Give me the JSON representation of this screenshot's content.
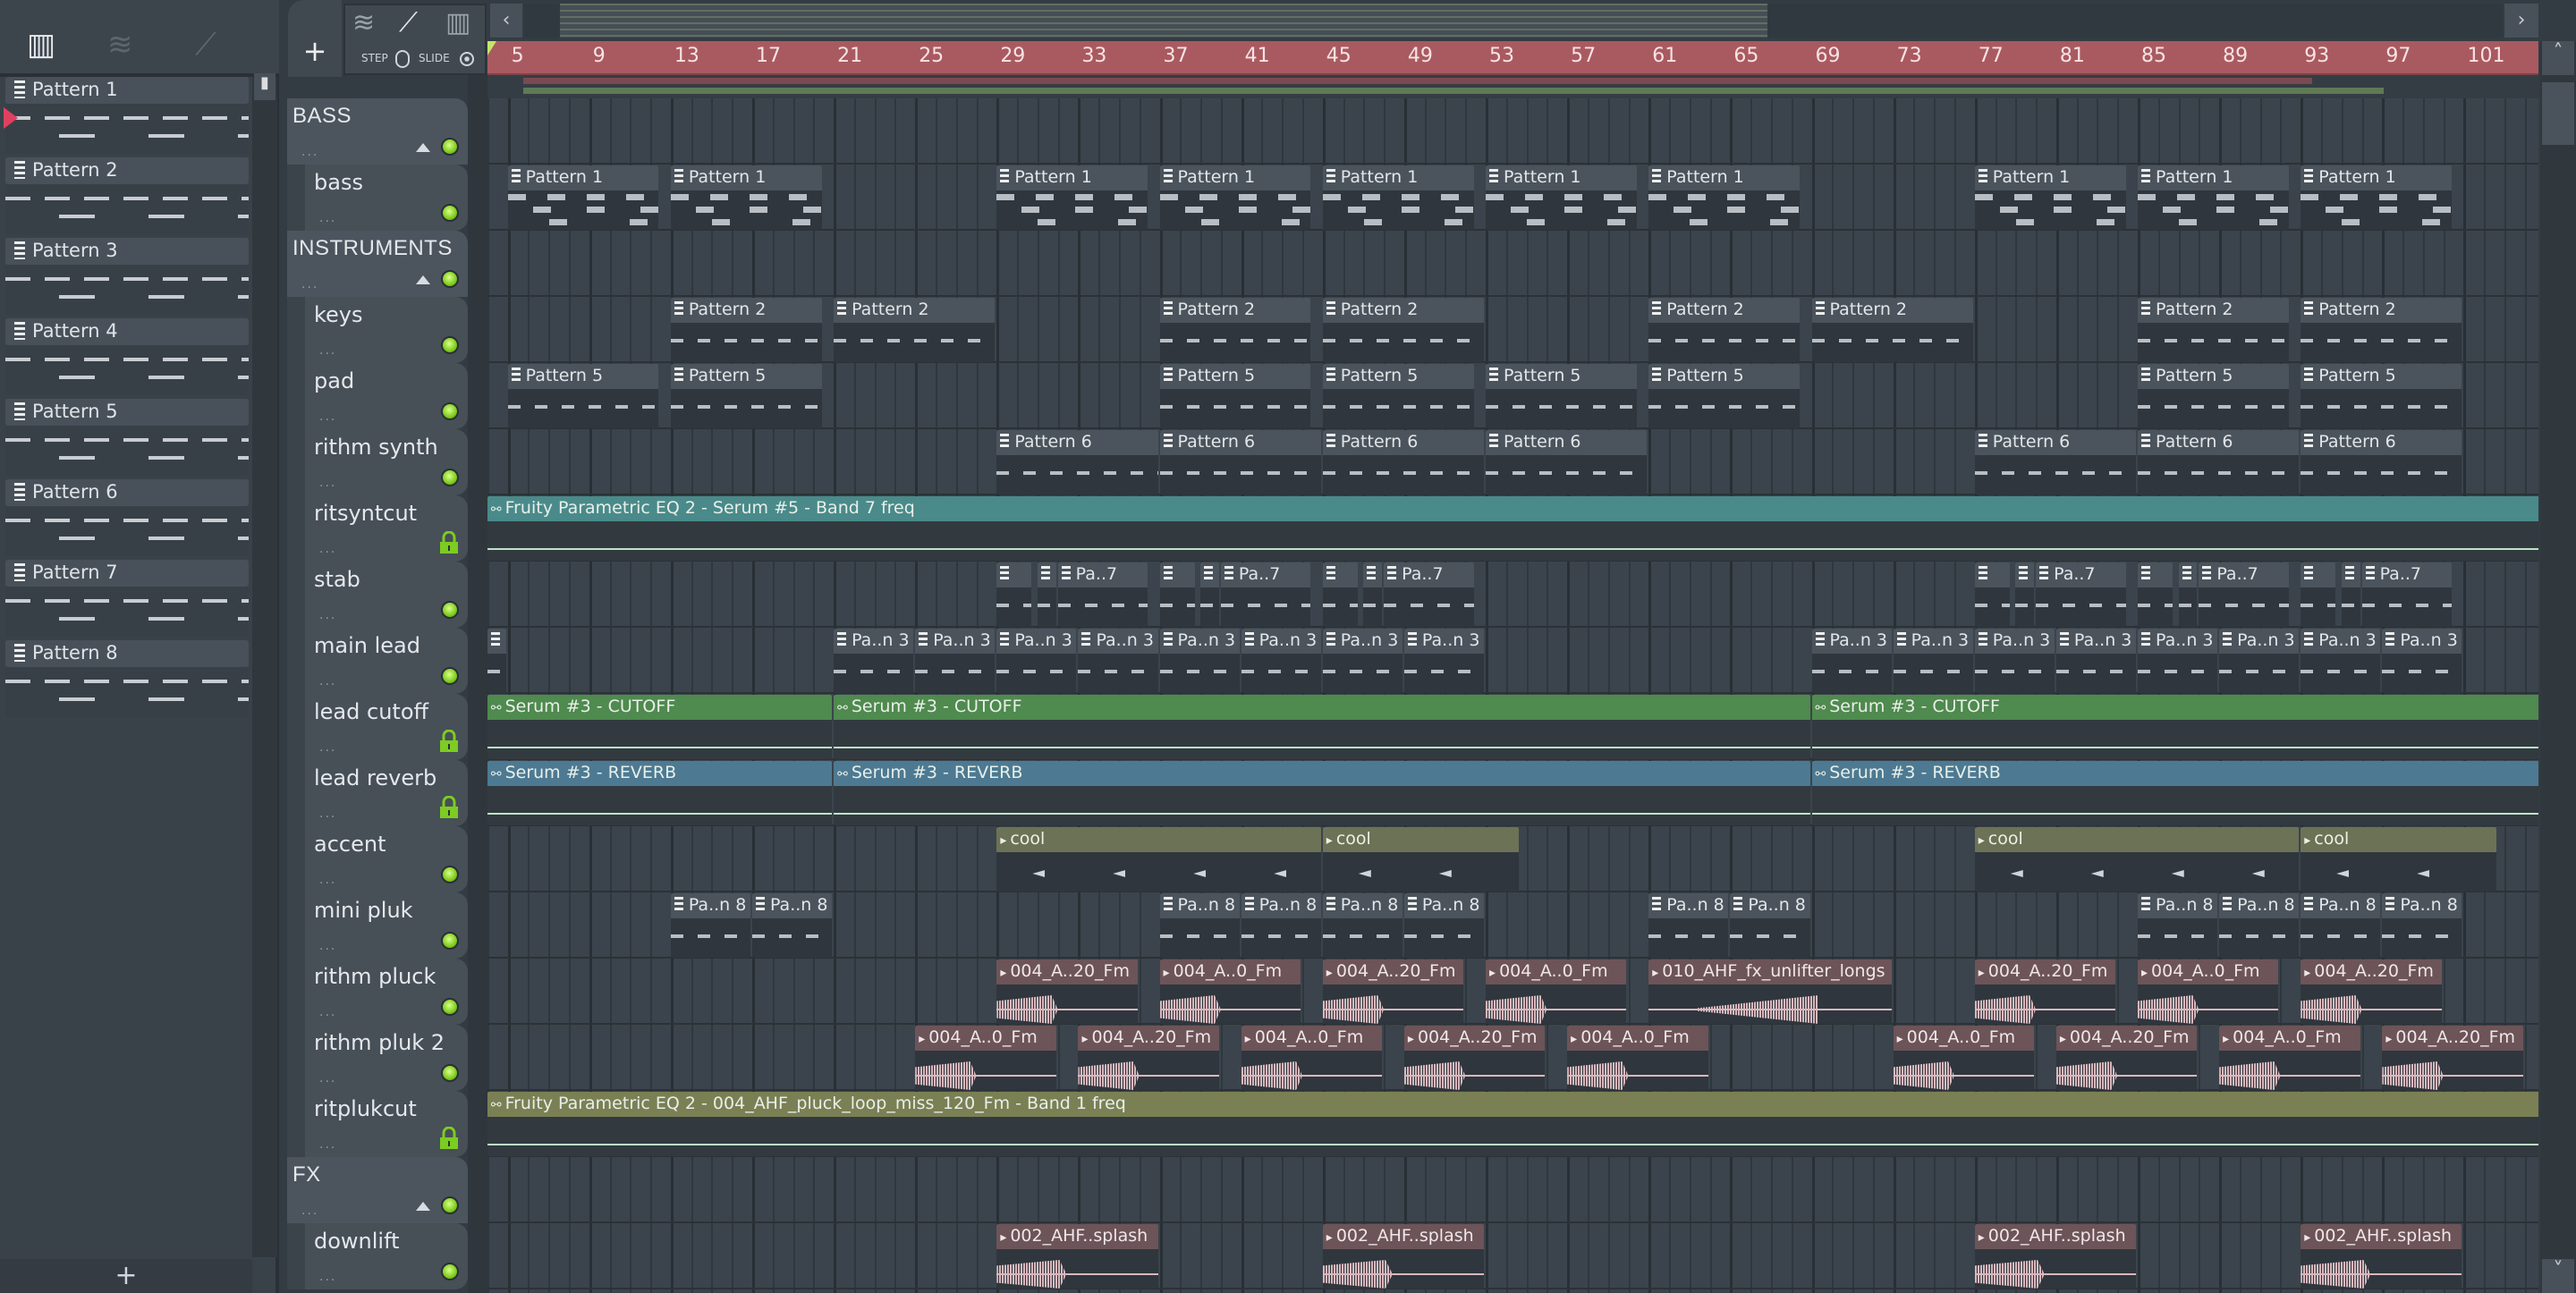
{
  "toolbar": {
    "left_icons": [
      "piano-roll-icon",
      "audio-wave-icon",
      "automation-icon"
    ],
    "add_label": "+",
    "step_label": "STEP",
    "slide_label": "SLIDE",
    "tool_icons": [
      "audio-wave-icon",
      "automation-icon",
      "piano-roll-icon"
    ],
    "scroll_left": "‹",
    "scroll_right": "›"
  },
  "patterns": [
    "Pattern 1",
    "Pattern 2",
    "Pattern 3",
    "Pattern 4",
    "Pattern 5",
    "Pattern 6",
    "Pattern 7",
    "Pattern 8"
  ],
  "add_pattern_label": "+",
  "ruler": {
    "first_bar_visible": 4,
    "labels": [
      5,
      9,
      13,
      17,
      21,
      25,
      29,
      33,
      37,
      41,
      45,
      49,
      53,
      57,
      61,
      65,
      69,
      73,
      77,
      81,
      85,
      89,
      93,
      97,
      101
    ]
  },
  "colors": {
    "ruler": "#a95a60",
    "led": "#7fcc1c",
    "teal_auto": "#4a8a8a",
    "green_auto": "#4f8a4e",
    "blue_auto": "#4d7a92",
    "olive_auto": "#7a8054",
    "audio": "#6c5458"
  },
  "tracks": [
    {
      "name": "BASS",
      "group": true
    },
    {
      "name": "bass",
      "clips": [
        {
          "type": "pattern",
          "label": "Pattern 1",
          "start": 5,
          "len": 7.5,
          "style": "bass"
        },
        {
          "type": "pattern",
          "label": "Pattern 1",
          "start": 13,
          "len": 7.5,
          "style": "bass"
        },
        {
          "type": "pattern",
          "label": "Pattern 1",
          "start": 29,
          "len": 7.5,
          "style": "bass"
        },
        {
          "type": "pattern",
          "label": "Pattern 1",
          "start": 37,
          "len": 7.5,
          "style": "bass"
        },
        {
          "type": "pattern",
          "label": "Pattern 1",
          "start": 45,
          "len": 7.5,
          "style": "bass"
        },
        {
          "type": "pattern",
          "label": "Pattern 1",
          "start": 53,
          "len": 7.5,
          "style": "bass"
        },
        {
          "type": "pattern",
          "label": "Pattern 1",
          "start": 61,
          "len": 7.5,
          "style": "bass"
        },
        {
          "type": "pattern",
          "label": "Pattern 1",
          "start": 77,
          "len": 7.5,
          "style": "bass"
        },
        {
          "type": "pattern",
          "label": "Pattern 1",
          "start": 85,
          "len": 7.5,
          "style": "bass"
        },
        {
          "type": "pattern",
          "label": "Pattern 1",
          "start": 93,
          "len": 7.5,
          "style": "bass"
        }
      ]
    },
    {
      "name": "INSTRUMENTS",
      "group": true
    },
    {
      "name": "keys",
      "clips": [
        {
          "type": "pattern",
          "label": "Pattern 2",
          "start": 13,
          "len": 7.5
        },
        {
          "type": "pattern",
          "label": "Pattern 2",
          "start": 21,
          "len": 8
        },
        {
          "type": "pattern",
          "label": "Pattern 2",
          "start": 37,
          "len": 7.5
        },
        {
          "type": "pattern",
          "label": "Pattern 2",
          "start": 45,
          "len": 8
        },
        {
          "type": "pattern",
          "label": "Pattern 2",
          "start": 61,
          "len": 7.5
        },
        {
          "type": "pattern",
          "label": "Pattern 2",
          "start": 69,
          "len": 8
        },
        {
          "type": "pattern",
          "label": "Pattern 2",
          "start": 85,
          "len": 7.5
        },
        {
          "type": "pattern",
          "label": "Pattern 2",
          "start": 93,
          "len": 8
        }
      ]
    },
    {
      "name": "pad",
      "clips": [
        {
          "type": "pattern",
          "label": "Pattern 5",
          "start": 5,
          "len": 7.5
        },
        {
          "type": "pattern",
          "label": "Pattern 5",
          "start": 13,
          "len": 7.5
        },
        {
          "type": "pattern",
          "label": "Pattern 5",
          "start": 37,
          "len": 7.5
        },
        {
          "type": "pattern",
          "label": "Pattern 5",
          "start": 45,
          "len": 7.5
        },
        {
          "type": "pattern",
          "label": "Pattern 5",
          "start": 53,
          "len": 7.5
        },
        {
          "type": "pattern",
          "label": "Pattern 5",
          "start": 61,
          "len": 7.5
        },
        {
          "type": "pattern",
          "label": "Pattern 5",
          "start": 85,
          "len": 7.5
        },
        {
          "type": "pattern",
          "label": "Pattern 5",
          "start": 93,
          "len": 8
        }
      ]
    },
    {
      "name": "rithm synth",
      "clips": [
        {
          "type": "pattern",
          "label": "Pattern 6",
          "start": 29,
          "len": 8
        },
        {
          "type": "pattern",
          "label": "Pattern 6",
          "start": 37,
          "len": 8
        },
        {
          "type": "pattern",
          "label": "Pattern 6",
          "start": 45,
          "len": 8
        },
        {
          "type": "pattern",
          "label": "Pattern 6",
          "start": 53,
          "len": 8
        },
        {
          "type": "pattern",
          "label": "Pattern 6",
          "start": 77,
          "len": 8
        },
        {
          "type": "pattern",
          "label": "Pattern 6",
          "start": 85,
          "len": 8
        },
        {
          "type": "pattern",
          "label": "Pattern 6",
          "start": 93,
          "len": 8
        }
      ]
    },
    {
      "name": "ritsyntcut",
      "locked": true,
      "clips": [
        {
          "type": "auto",
          "label": "Fruity Parametric EQ 2 - Serum #5 - Band 7 freq",
          "start": 4,
          "len": 101,
          "color": "teal_auto"
        }
      ]
    },
    {
      "name": "stab",
      "clips": [
        {
          "type": "pattern",
          "label": "",
          "start": 29,
          "len": 1.8
        },
        {
          "type": "pattern",
          "label": "",
          "start": 31,
          "len": 1
        },
        {
          "type": "pattern",
          "label": "Pa..7",
          "start": 32,
          "len": 4.5
        },
        {
          "type": "pattern",
          "label": "",
          "start": 37,
          "len": 1.8
        },
        {
          "type": "pattern",
          "label": "",
          "start": 39,
          "len": 1
        },
        {
          "type": "pattern",
          "label": "Pa..7",
          "start": 40,
          "len": 4.5
        },
        {
          "type": "pattern",
          "label": "",
          "start": 45,
          "len": 1.8
        },
        {
          "type": "pattern",
          "label": "",
          "start": 47,
          "len": 1
        },
        {
          "type": "pattern",
          "label": "Pa..7",
          "start": 48,
          "len": 4.5
        },
        {
          "type": "pattern",
          "label": "",
          "start": 77,
          "len": 1.8
        },
        {
          "type": "pattern",
          "label": "",
          "start": 79,
          "len": 1
        },
        {
          "type": "pattern",
          "label": "Pa..7",
          "start": 80,
          "len": 4.5
        },
        {
          "type": "pattern",
          "label": "",
          "start": 85,
          "len": 1.8
        },
        {
          "type": "pattern",
          "label": "",
          "start": 87,
          "len": 1
        },
        {
          "type": "pattern",
          "label": "Pa..7",
          "start": 88,
          "len": 4.5
        },
        {
          "type": "pattern",
          "label": "",
          "start": 93,
          "len": 1.8
        },
        {
          "type": "pattern",
          "label": "",
          "start": 95,
          "len": 1
        },
        {
          "type": "pattern",
          "label": "Pa..7",
          "start": 96,
          "len": 4.5
        }
      ]
    },
    {
      "name": "main lead",
      "clips": [
        {
          "type": "pattern",
          "label": "",
          "start": 4,
          "len": 1
        },
        {
          "type": "pattern",
          "label": "Pa..n 3",
          "start": 21,
          "len": 4
        },
        {
          "type": "pattern",
          "label": "Pa..n 3",
          "start": 25,
          "len": 4
        },
        {
          "type": "pattern",
          "label": "Pa..n 3",
          "start": 29,
          "len": 4
        },
        {
          "type": "pattern",
          "label": "Pa..n 3",
          "start": 33,
          "len": 4
        },
        {
          "type": "pattern",
          "label": "Pa..n 3",
          "start": 37,
          "len": 4
        },
        {
          "type": "pattern",
          "label": "Pa..n 3",
          "start": 41,
          "len": 4
        },
        {
          "type": "pattern",
          "label": "Pa..n 3",
          "start": 45,
          "len": 4
        },
        {
          "type": "pattern",
          "label": "Pa..n 3",
          "start": 49,
          "len": 4
        },
        {
          "type": "pattern",
          "label": "Pa..n 3",
          "start": 69,
          "len": 4
        },
        {
          "type": "pattern",
          "label": "Pa..n 3",
          "start": 73,
          "len": 4
        },
        {
          "type": "pattern",
          "label": "Pa..n 3",
          "start": 77,
          "len": 4
        },
        {
          "type": "pattern",
          "label": "Pa..n 3",
          "start": 81,
          "len": 4
        },
        {
          "type": "pattern",
          "label": "Pa..n 3",
          "start": 85,
          "len": 4
        },
        {
          "type": "pattern",
          "label": "Pa..n 3",
          "start": 89,
          "len": 4
        },
        {
          "type": "pattern",
          "label": "Pa..n 3",
          "start": 93,
          "len": 4
        },
        {
          "type": "pattern",
          "label": "Pa..n 3",
          "start": 97,
          "len": 4
        }
      ]
    },
    {
      "name": "lead cutoff",
      "locked": true,
      "clips": [
        {
          "type": "auto",
          "label": "Serum #3 - CUTOFF",
          "start": 4,
          "len": 17,
          "color": "green_auto"
        },
        {
          "type": "auto",
          "label": "Serum #3 - CUTOFF",
          "start": 21,
          "len": 48,
          "color": "green_auto"
        },
        {
          "type": "auto",
          "label": "Serum #3 - CUTOFF",
          "start": 69,
          "len": 36,
          "color": "green_auto"
        }
      ]
    },
    {
      "name": "lead reverb",
      "locked": true,
      "clips": [
        {
          "type": "auto",
          "label": "Serum #3 - REVERB",
          "start": 4,
          "len": 17,
          "color": "blue_auto"
        },
        {
          "type": "auto",
          "label": "Serum #3 - REVERB",
          "start": 21,
          "len": 48,
          "color": "blue_auto"
        },
        {
          "type": "auto",
          "label": "Serum #3 - REVERB",
          "start": 69,
          "len": 36,
          "color": "blue_auto"
        }
      ]
    },
    {
      "name": "accent",
      "clips": [
        {
          "type": "cool",
          "label": "cool",
          "start": 29,
          "len": 16
        },
        {
          "type": "cool",
          "label": "cool",
          "start": 45,
          "len": 9.7
        },
        {
          "type": "cool",
          "label": "cool",
          "start": 77,
          "len": 16
        },
        {
          "type": "cool",
          "label": "cool",
          "start": 93,
          "len": 9.7
        }
      ]
    },
    {
      "name": "mini pluk",
      "clips": [
        {
          "type": "pattern",
          "label": "Pa..n 8",
          "start": 13,
          "len": 4
        },
        {
          "type": "pattern",
          "label": "Pa..n 8",
          "start": 17,
          "len": 4
        },
        {
          "type": "pattern",
          "label": "Pa..n 8",
          "start": 37,
          "len": 4
        },
        {
          "type": "pattern",
          "label": "Pa..n 8",
          "start": 41,
          "len": 4
        },
        {
          "type": "pattern",
          "label": "Pa..n 8",
          "start": 45,
          "len": 4
        },
        {
          "type": "pattern",
          "label": "Pa..n 8",
          "start": 49,
          "len": 4
        },
        {
          "type": "pattern",
          "label": "Pa..n 8",
          "start": 61,
          "len": 4
        },
        {
          "type": "pattern",
          "label": "Pa..n 8",
          "start": 65,
          "len": 4
        },
        {
          "type": "pattern",
          "label": "Pa..n 8",
          "start": 85,
          "len": 4
        },
        {
          "type": "pattern",
          "label": "Pa..n 8",
          "start": 89,
          "len": 4
        },
        {
          "type": "pattern",
          "label": "Pa..n 8",
          "start": 93,
          "len": 4
        },
        {
          "type": "pattern",
          "label": "Pa..n 8",
          "start": 97,
          "len": 4
        }
      ]
    },
    {
      "name": "rithm pluck",
      "clips": [
        {
          "type": "audio",
          "label": "004_A..20_Fm",
          "start": 29,
          "len": 7
        },
        {
          "type": "audio",
          "label": "004_A..0_Fm",
          "start": 37,
          "len": 7
        },
        {
          "type": "audio",
          "label": "004_A..20_Fm",
          "start": 45,
          "len": 7
        },
        {
          "type": "audio",
          "label": "004_A..0_Fm",
          "start": 53,
          "len": 7
        },
        {
          "type": "audio",
          "label": "010_AHF_fx_unlifter_longs",
          "start": 61,
          "len": 12,
          "rise": true
        },
        {
          "type": "audio",
          "label": "004_A..20_Fm",
          "start": 77,
          "len": 7
        },
        {
          "type": "audio",
          "label": "004_A..0_Fm",
          "start": 85,
          "len": 7
        },
        {
          "type": "audio",
          "label": "004_A..20_Fm",
          "start": 93,
          "len": 7
        }
      ]
    },
    {
      "name": "rithm pluk 2",
      "clips": [
        {
          "type": "audio",
          "label": "004_A..0_Fm",
          "start": 25,
          "len": 7
        },
        {
          "type": "audio",
          "label": "004_A..20_Fm",
          "start": 33,
          "len": 7
        },
        {
          "type": "audio",
          "label": "004_A..0_Fm",
          "start": 41,
          "len": 7
        },
        {
          "type": "audio",
          "label": "004_A..20_Fm",
          "start": 49,
          "len": 7
        },
        {
          "type": "audio",
          "label": "004_A..0_Fm",
          "start": 57,
          "len": 7
        },
        {
          "type": "audio",
          "label": "004_A..0_Fm",
          "start": 73,
          "len": 7
        },
        {
          "type": "audio",
          "label": "004_A..20_Fm",
          "start": 81,
          "len": 7
        },
        {
          "type": "audio",
          "label": "004_A..0_Fm",
          "start": 89,
          "len": 7
        },
        {
          "type": "audio",
          "label": "004_A..20_Fm",
          "start": 97,
          "len": 7
        }
      ]
    },
    {
      "name": "ritplukcut",
      "locked": true,
      "clips": [
        {
          "type": "auto",
          "label": "Fruity Parametric EQ 2 - 004_AHF_pluck_loop_miss_120_Fm - Band 1 freq",
          "start": 4,
          "len": 101,
          "color": "olive_auto"
        }
      ]
    },
    {
      "name": "FX",
      "group": true
    },
    {
      "name": "downlift",
      "clips": [
        {
          "type": "audio",
          "label": "002_AHF..splash",
          "start": 29,
          "len": 8
        },
        {
          "type": "audio",
          "label": "002_AHF..splash",
          "start": 45,
          "len": 8
        },
        {
          "type": "audio",
          "label": "002_AHF..splash",
          "start": 77,
          "len": 8
        },
        {
          "type": "audio",
          "label": "002_AHF..splash",
          "start": 93,
          "len": 8
        }
      ]
    }
  ]
}
